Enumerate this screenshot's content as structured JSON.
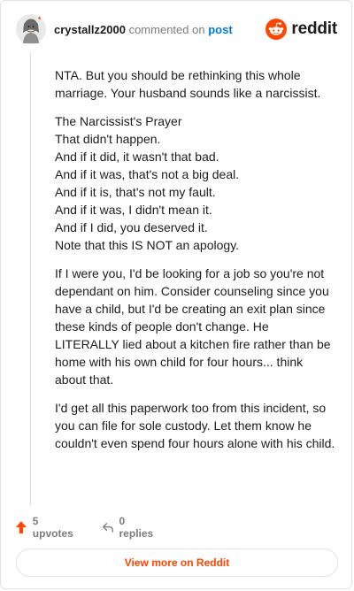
{
  "header": {
    "username": "crystallz2000",
    "commented_on": "commented on",
    "post_link": "post",
    "brand": "reddit"
  },
  "comment": {
    "p1": "NTA. But you should be rethinking this whole marriage. Your husband sounds like a narcissist.",
    "poem": [
      "The Narcissist's Prayer",
      "That didn't happen.",
      "And if it did, it wasn't that bad.",
      "And if it was, that's not a big deal.",
      "And if it is, that's not my fault.",
      "And if it was, I didn't mean it.",
      "And if I did, you deserved it.",
      "Note that this IS NOT an apology."
    ],
    "p2": "If I were you, I'd be looking for a job so you're not dependant on him. Consider counseling since you have a child, but I'd be creating an exit plan since these kinds of people don't change. He LITERALLY lied about a kitchen fire rather than be home with his own child for four hours... think about that.",
    "p3": "I'd get all this paperwork too from this incident, so you can file for sole custody. Let them know he couldn't even spend four hours alone with his child."
  },
  "actions": {
    "upvotes": "5 upvotes",
    "replies": "0 replies"
  },
  "footer": {
    "view_more": "View more on Reddit"
  },
  "colors": {
    "brand": "#ff4500",
    "link": "#0079d3",
    "muted": "#7c7c7c"
  },
  "icons": [
    "avatar",
    "reddit-logo-icon",
    "upvote-arrow-icon",
    "reply-arrow-icon"
  ]
}
